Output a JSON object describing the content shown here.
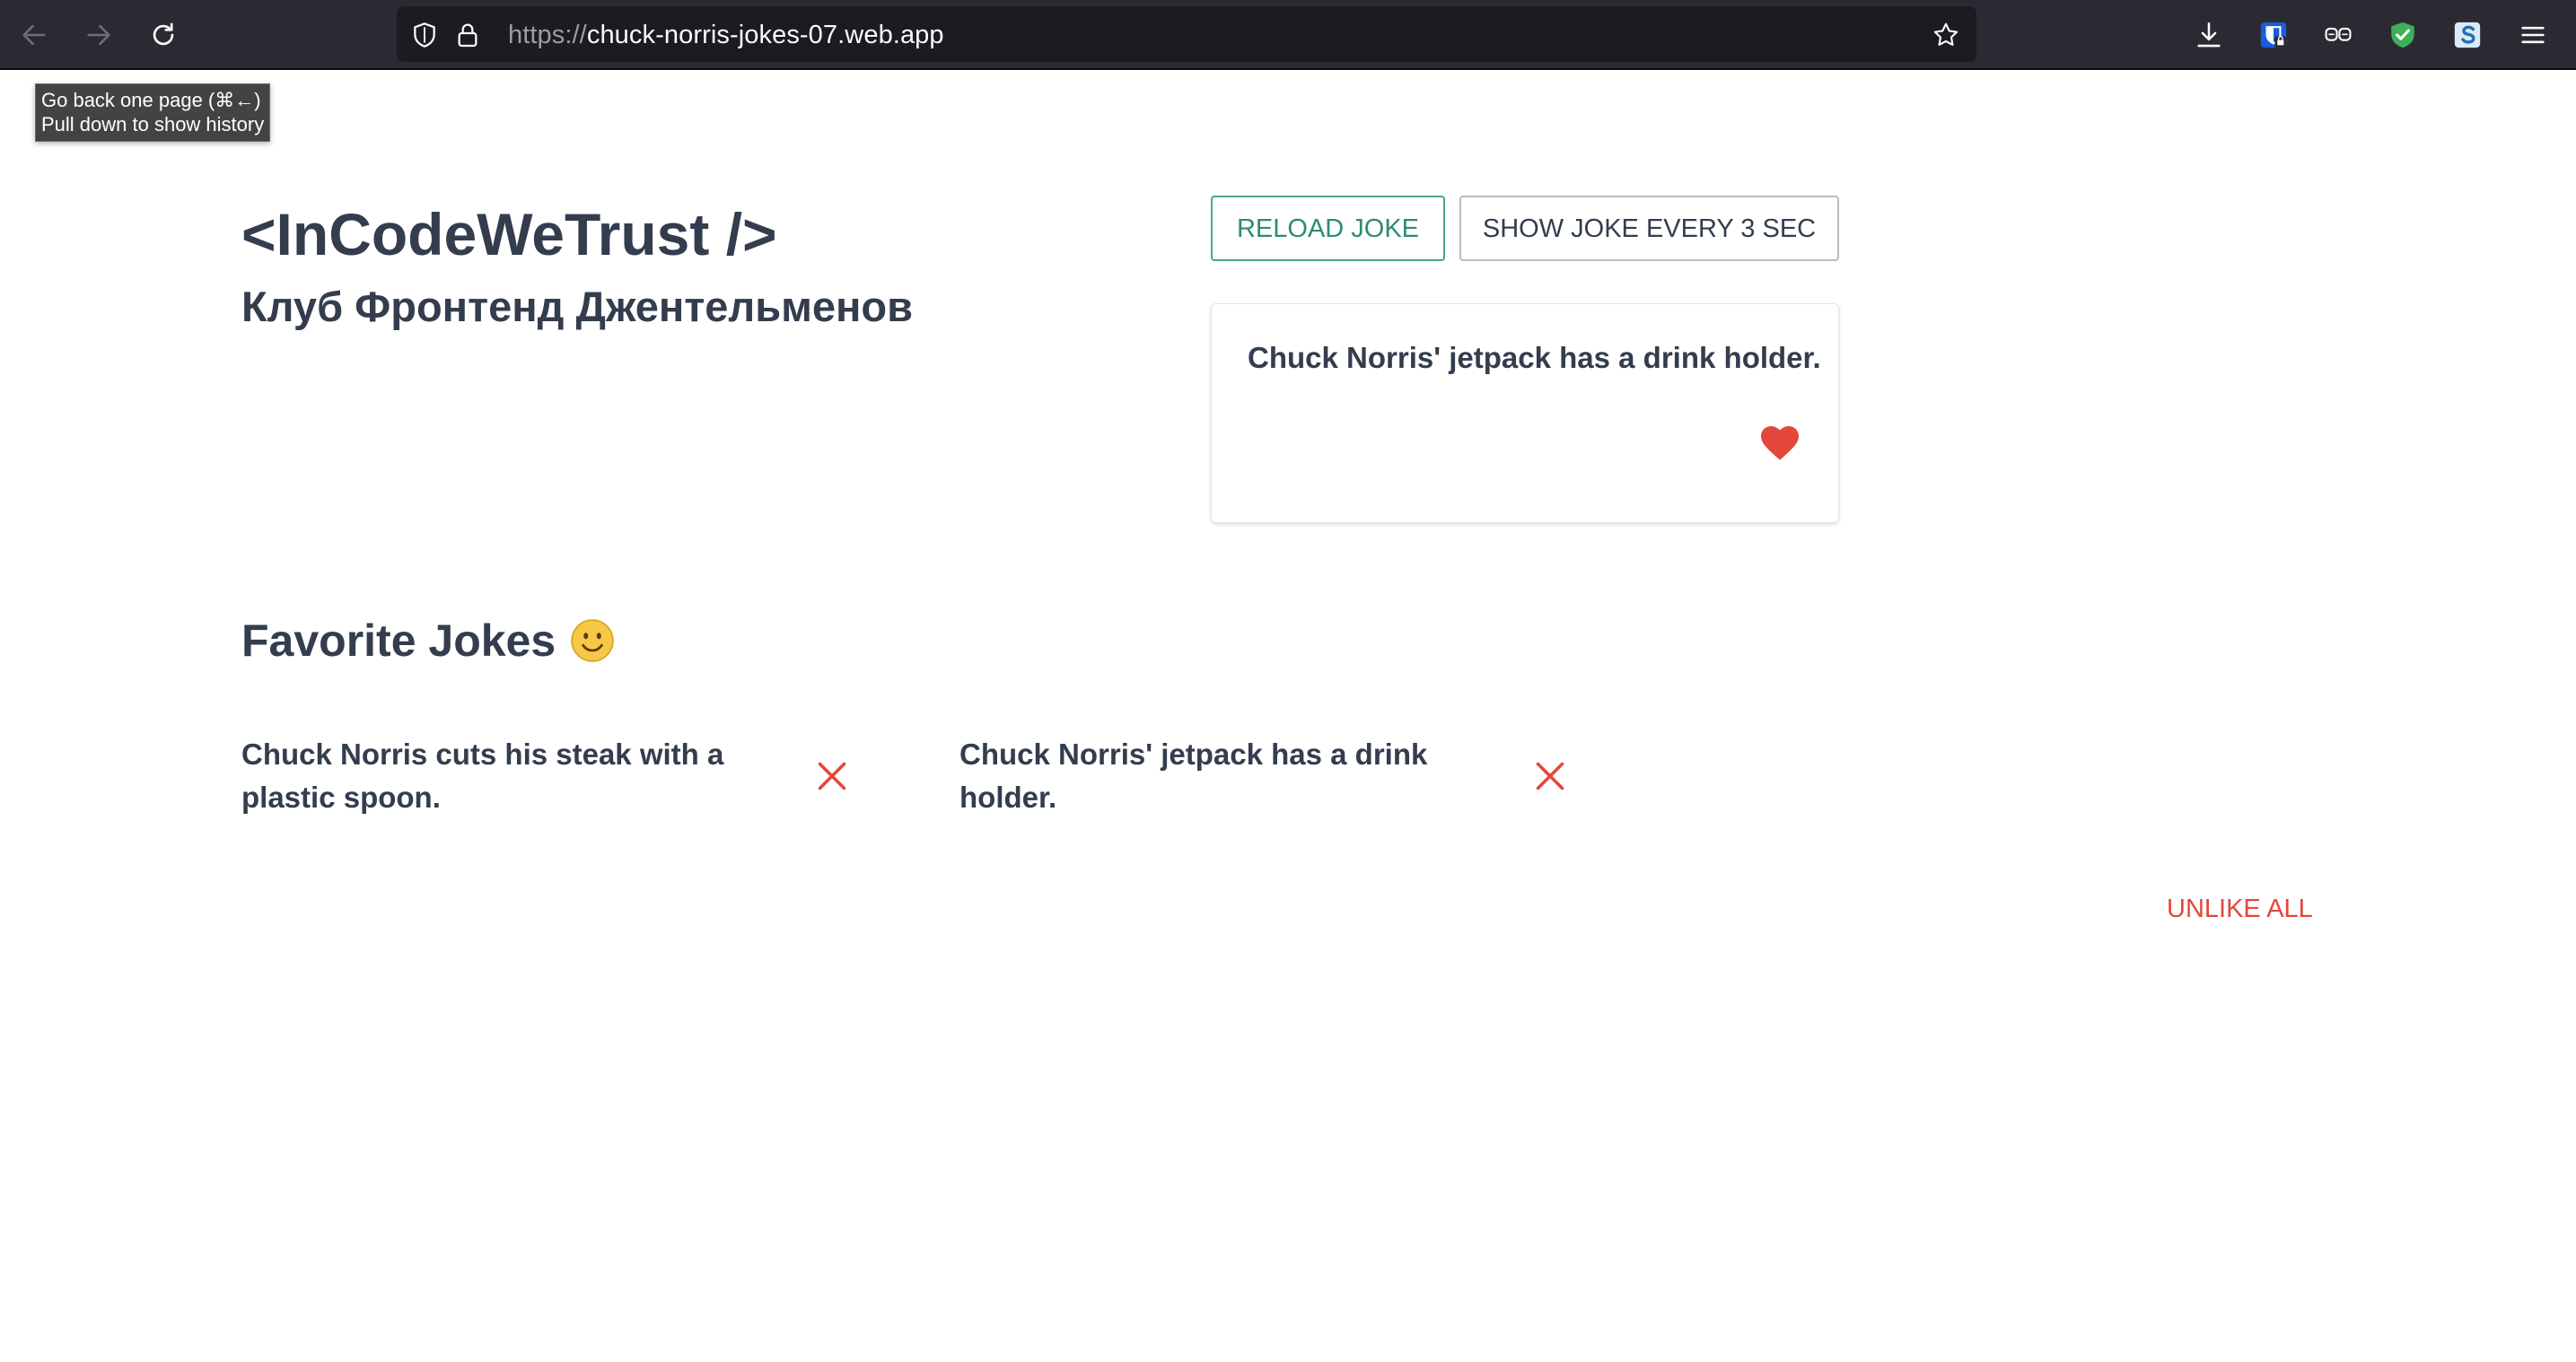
{
  "browser": {
    "url_scheme": "https://",
    "url_host": "chuck-norris-jokes-07.web.app",
    "tooltip_line1": "Go back one page (⌘←)",
    "tooltip_line2": "Pull down to show history",
    "icons": [
      "back-arrow-icon",
      "forward-arrow-icon",
      "reload-icon",
      "shield-icon",
      "lock-icon",
      "star-icon",
      "download-icon",
      "bitwarden-icon",
      "reader-glasses-icon",
      "adblock-shield-icon",
      "extension-s-icon",
      "hamburger-menu-icon"
    ]
  },
  "header": {
    "title": "<InCodeWeTrust />",
    "subtitle": "Клуб Фронтенд Джентельменов"
  },
  "controls": {
    "reload_label": "RELOAD JOKE",
    "auto_label": "SHOW JOKE EVERY 3 SEC"
  },
  "current_joke": {
    "text": "Chuck Norris' jetpack has a drink holder.",
    "liked": true
  },
  "favorites": {
    "title": "Favorite Jokes",
    "items": [
      {
        "text": "Chuck Norris cuts his steak with a plastic spoon."
      },
      {
        "text": "Chuck Norris' jetpack has a drink holder."
      }
    ],
    "unlike_all_label": "UNLIKE ALL"
  },
  "colors": {
    "text": "#333d4e",
    "accent_green": "#2e8b73",
    "accent_red": "#e4473c",
    "toolbar": "#2b2a33"
  }
}
